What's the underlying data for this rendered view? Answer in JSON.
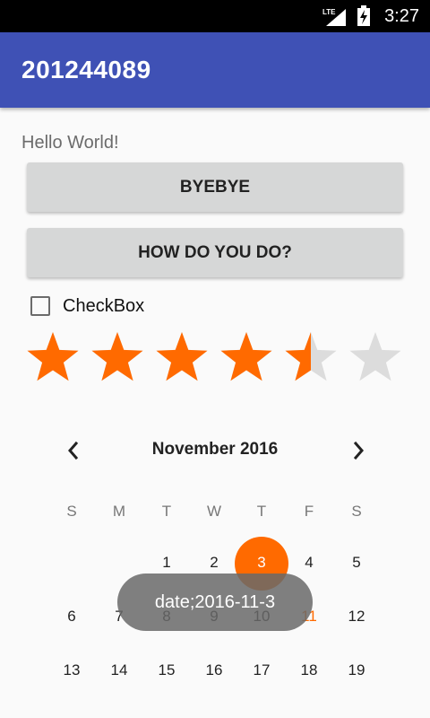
{
  "status_bar": {
    "time": "3:27",
    "network": "LTE"
  },
  "app_bar": {
    "title": "201244089"
  },
  "content": {
    "hello_text": "Hello World!",
    "button1_label": "BYEBYE",
    "button2_label": "HOW DO YOU DO?",
    "checkbox_label": "CheckBox",
    "checkbox_checked": false
  },
  "rating": {
    "value": 4.5,
    "max": 6,
    "filled_color": "#ff6a00",
    "empty_color": "#dcdcdc"
  },
  "calendar": {
    "month_label": "November 2016",
    "weekdays": [
      "S",
      "M",
      "T",
      "W",
      "T",
      "F",
      "S"
    ],
    "rows": [
      [
        "",
        "",
        "1",
        "2",
        "3",
        "4",
        "5"
      ],
      [
        "6",
        "7",
        "8",
        "9",
        "10",
        "11",
        "12"
      ],
      [
        "13",
        "14",
        "15",
        "16",
        "17",
        "18",
        "19"
      ]
    ],
    "selected_day": "3",
    "today_day": "11",
    "accent_color": "#ff6a00"
  },
  "toast": {
    "text": "date;2016-11-3"
  },
  "colors": {
    "primary": "#3f51b5",
    "accent": "#ff6a00"
  }
}
